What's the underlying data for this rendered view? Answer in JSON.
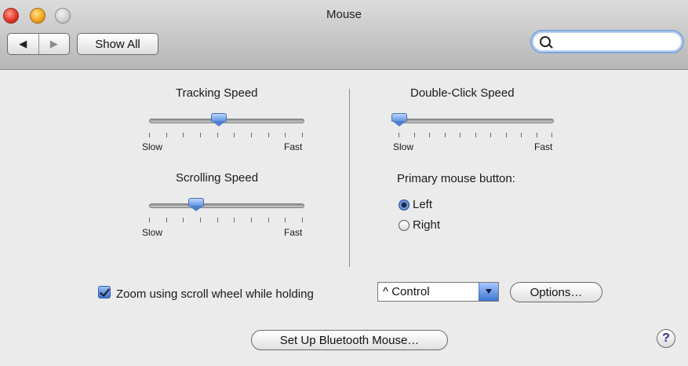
{
  "window": {
    "title": "Mouse"
  },
  "toolbar": {
    "back_glyph": "◀",
    "forward_glyph": "▶",
    "show_all_label": "Show All",
    "search": {
      "value": "",
      "placeholder": ""
    }
  },
  "tracking": {
    "label": "Tracking Speed",
    "min_label": "Slow",
    "max_label": "Fast",
    "value": 0.45
  },
  "scrolling": {
    "label": "Scrolling Speed",
    "min_label": "Slow",
    "max_label": "Fast",
    "value": 0.3
  },
  "double_click": {
    "label": "Double-Click Speed",
    "min_label": "Slow",
    "max_label": "Fast",
    "value": 0.0
  },
  "primary_button": {
    "label": "Primary mouse button:",
    "left_label": "Left",
    "right_label": "Right",
    "selected": "Left"
  },
  "zoom": {
    "checked": true,
    "label": "Zoom using scroll wheel while holding",
    "modifier_value": "^ Control",
    "options_button": "Options…"
  },
  "bluetooth_button": "Set Up Bluetooth Mouse…",
  "help": {
    "label": "?"
  },
  "colors": {
    "accent": "#3d72d1",
    "window_bg": "#ebebeb",
    "titlebar_gradient_top": "#dcdcdc",
    "titlebar_gradient_bottom": "#b6b6b6"
  },
  "icons": {
    "close": "close-button",
    "minimize": "minimize-button",
    "zoom": "zoom-button",
    "search": "search-icon",
    "help": "help-icon"
  }
}
